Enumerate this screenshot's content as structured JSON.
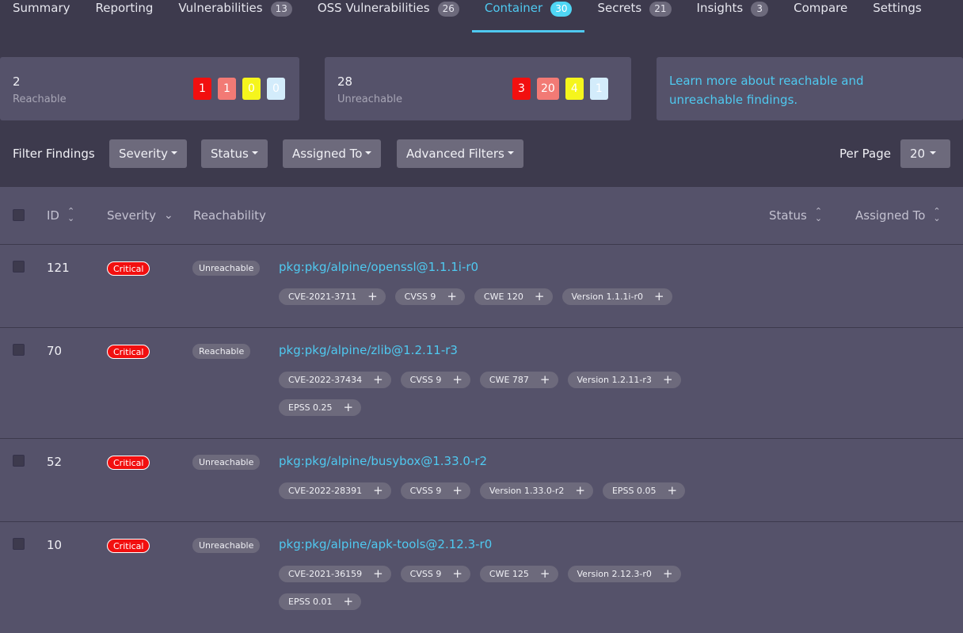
{
  "tabs": [
    {
      "label": "Summary",
      "count": null
    },
    {
      "label": "Reporting",
      "count": null
    },
    {
      "label": "Vulnerabilities",
      "count": "13"
    },
    {
      "label": "OSS Vulnerabilities",
      "count": "26"
    },
    {
      "label": "Container",
      "count": "30"
    },
    {
      "label": "Secrets",
      "count": "21"
    },
    {
      "label": "Insights",
      "count": "3"
    },
    {
      "label": "Compare",
      "count": null
    },
    {
      "label": "Settings",
      "count": null
    }
  ],
  "summary": {
    "reachable": {
      "count": "2",
      "label": "Reachable",
      "critical": "1",
      "high": "1",
      "medium": "0",
      "low": "0"
    },
    "unreachable": {
      "count": "28",
      "label": "Unreachable",
      "critical": "3",
      "high": "20",
      "medium": "4",
      "low": "1"
    },
    "learn_more": "Learn more about reachable and unreachable findings."
  },
  "filters": {
    "label": "Filter Findings",
    "severity": "Severity",
    "status": "Status",
    "assigned_to": "Assigned To",
    "advanced": "Advanced Filters",
    "per_page_label": "Per Page",
    "per_page_value": "20"
  },
  "table": {
    "headers": {
      "id": "ID",
      "severity": "Severity",
      "reachability": "Reachability",
      "status": "Status",
      "assigned_to": "Assigned To"
    },
    "rows": [
      {
        "id": "121",
        "severity": "Critical",
        "reachability": "Unreachable",
        "package": "pkg:pkg/alpine/openssl@1.1.1i-r0",
        "tags": [
          "CVE-2021-3711",
          "CVSS 9",
          "CWE 120",
          "Version 1.1.1i-r0"
        ]
      },
      {
        "id": "70",
        "severity": "Critical",
        "reachability": "Reachable",
        "package": "pkg:pkg/alpine/zlib@1.2.11-r3",
        "tags": [
          "CVE-2022-37434",
          "CVSS 9",
          "CWE 787",
          "Version 1.2.11-r3",
          "EPSS 0.25"
        ]
      },
      {
        "id": "52",
        "severity": "Critical",
        "reachability": "Unreachable",
        "package": "pkg:pkg/alpine/busybox@1.33.0-r2",
        "tags": [
          "CVE-2022-28391",
          "CVSS 9",
          "Version 1.33.0-r2",
          "EPSS 0.05"
        ]
      },
      {
        "id": "10",
        "severity": "Critical",
        "reachability": "Unreachable",
        "package": "pkg:pkg/alpine/apk-tools@2.12.3-r0",
        "tags": [
          "CVE-2021-36159",
          "CVSS 9",
          "CWE 125",
          "Version 2.12.3-r0",
          "EPSS 0.01"
        ]
      }
    ]
  },
  "colors": {
    "accent": "#4fc9f0",
    "critical": "#f20f0f",
    "high": "#f27a75",
    "medium": "#f5f51c",
    "low": "#d3ecfb"
  }
}
